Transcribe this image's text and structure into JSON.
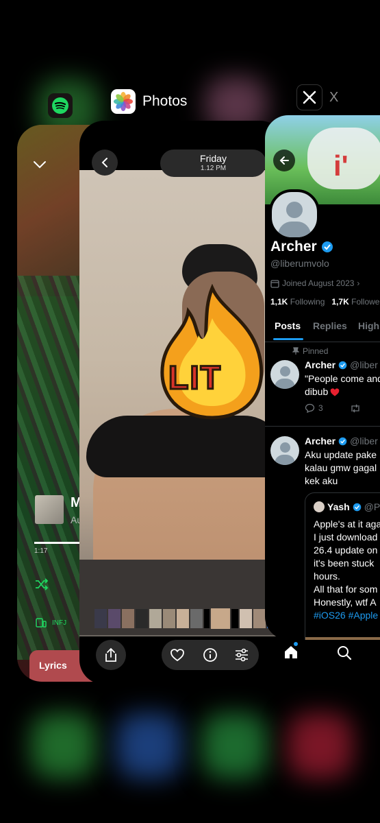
{
  "switcher": {
    "photos_label": "Photos",
    "x_label": "X"
  },
  "spotify": {
    "time_elapsed": "1:17",
    "track_initial": "M",
    "artist_initial": "Au",
    "device_label": "INFJ",
    "lyrics_label": "Lyrics"
  },
  "photos": {
    "day": "Friday",
    "time": "1.12 PM",
    "sticker_text": "LIT"
  },
  "x": {
    "name": "Archer",
    "handle": "@liberumvolo",
    "joined": "Joined August 2023",
    "following_count": "1,1K",
    "following_label": "Following",
    "followers_count": "1,7K",
    "followers_label": "Followe",
    "tabs": [
      "Posts",
      "Replies",
      "High"
    ],
    "pinned_label": "Pinned",
    "posts": [
      {
        "author": "Archer",
        "handle": "@liber",
        "line1": "\"People come and",
        "line2": "dibub",
        "replies": "3"
      },
      {
        "author": "Archer",
        "handle": "@liber",
        "line1": "Aku update pake",
        "line2": "kalau gmw gagal",
        "line3": "kek aku"
      }
    ],
    "quote": {
      "author": "Yash",
      "handle": "@P",
      "lines": [
        "Apple's at it aga",
        "I just download",
        "26.4 update on",
        "it's been stuck",
        "hours.",
        "All that for som",
        "Honestly, wtf A"
      ],
      "hashtags": "#iOS26 #Apple"
    }
  }
}
